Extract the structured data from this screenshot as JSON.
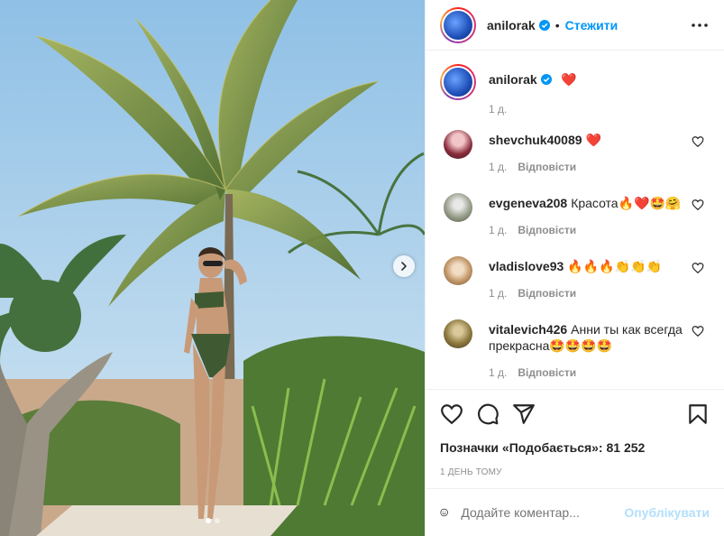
{
  "header": {
    "username": "anilorak",
    "separator": "•",
    "follow_label": "Стежити"
  },
  "caption": {
    "username": "anilorak",
    "text": "❤️",
    "age": "1 д."
  },
  "comments": [
    {
      "username": "shevchuk40089",
      "text": "❤️",
      "age": "1 д.",
      "reply": "Відповісти"
    },
    {
      "username": "evgeneva208",
      "text": "Красота🔥❤️🤩🤗",
      "age": "1 д.",
      "reply": "Відповісти"
    },
    {
      "username": "vladislove93",
      "text": "🔥🔥🔥👏👏👏",
      "age": "1 д.",
      "reply": "Відповісти"
    },
    {
      "username": "vitalevich426",
      "text": "Анни ты как всегда прекрасна🤩🤩🤩🤩",
      "age": "1 д.",
      "reply": "Відповісти"
    }
  ],
  "likes_text": "Позначки «Подобається»: 81 252",
  "date_text": "1 ДЕНЬ ТОМУ",
  "comment_box": {
    "placeholder": "Додайте коментар...",
    "post_label": "Опублікувати"
  },
  "carousel": {
    "dots": 2,
    "active": 0
  },
  "colors": {
    "accent": "#0095f6",
    "heart": "#ed4956",
    "muted": "#8e8e8e",
    "post_disabled": "#b2dffc"
  },
  "icons": [
    "verified-badge-icon",
    "more-options-icon",
    "heart-icon",
    "comment-icon",
    "share-icon",
    "bookmark-icon",
    "emoji-icon",
    "chevron-right-icon"
  ]
}
